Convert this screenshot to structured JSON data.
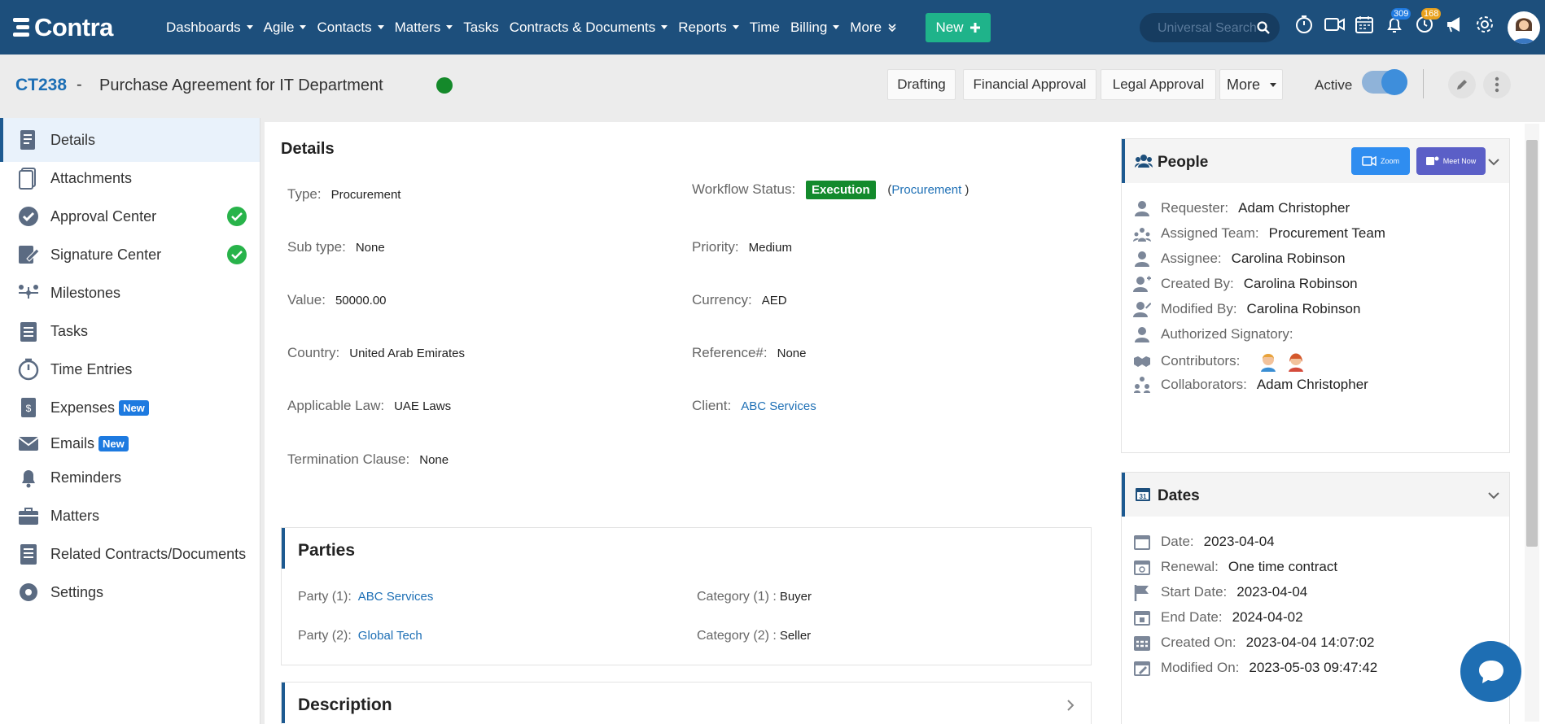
{
  "nav": {
    "brand": "Contra",
    "menu": [
      {
        "label": "Dashboards",
        "dropdown": true
      },
      {
        "label": "Agile",
        "dropdown": true
      },
      {
        "label": "Contacts",
        "dropdown": true
      },
      {
        "label": "Matters",
        "dropdown": true
      },
      {
        "label": "Tasks",
        "dropdown": false
      },
      {
        "label": "Contracts & Documents",
        "dropdown": true
      },
      {
        "label": "Reports",
        "dropdown": true
      },
      {
        "label": "Time",
        "dropdown": false
      },
      {
        "label": "Billing",
        "dropdown": true
      },
      {
        "label": "More",
        "dropdown": true
      }
    ],
    "new_label": "New",
    "search_placeholder": "Universal Search",
    "notifications_count": "309",
    "reminders_count": "168"
  },
  "header": {
    "id": "CT238",
    "dash": "-",
    "title": "Purchase Agreement for IT Department",
    "stages": [
      "Drafting",
      "Financial Approval",
      "Legal Approval"
    ],
    "more_label": "More",
    "active_label": "Active",
    "active_on": true
  },
  "sidebar": {
    "items": [
      {
        "label": "Details",
        "icon": "details-icon",
        "active": true
      },
      {
        "label": "Attachments",
        "icon": "attachments-icon"
      },
      {
        "label": "Approval Center",
        "icon": "approval-badge-icon",
        "check": true
      },
      {
        "label": "Signature Center",
        "icon": "signature-icon",
        "check": true
      },
      {
        "label": "Milestones",
        "icon": "milestones-icon"
      },
      {
        "label": "Tasks",
        "icon": "tasks-clipboard-icon"
      },
      {
        "label": "Time Entries",
        "icon": "stopwatch-icon"
      },
      {
        "label": "Expenses",
        "icon": "expenses-icon",
        "badge": "New"
      },
      {
        "label": "Emails",
        "icon": "email-icon",
        "badge": "New"
      },
      {
        "label": "Reminders",
        "icon": "bell-icon"
      },
      {
        "label": "Matters",
        "icon": "briefcase-icon"
      },
      {
        "label": "Related Contracts/Documents",
        "icon": "related-docs-icon"
      },
      {
        "label": "Settings",
        "icon": "gear-icon"
      }
    ]
  },
  "details": {
    "heading": "Details",
    "type_label": "Type:",
    "type_value": "Procurement",
    "subtype_label": "Sub type:",
    "subtype_value": "None",
    "value_label": "Value:",
    "value_value": "50000.00",
    "country_label": "Country:",
    "country_value": "United Arab Emirates",
    "law_label": "Applicable Law:",
    "law_value": "UAE Laws",
    "termination_label": "Termination Clause:",
    "termination_value": "None",
    "workflow_label": "Workflow Status:",
    "workflow_value": "Execution",
    "workflow_link": "Procurement",
    "priority_label": "Priority:",
    "priority_value": "Medium",
    "currency_label": "Currency:",
    "currency_value": "AED",
    "reference_label": "Reference#:",
    "reference_value": "None",
    "client_label": "Client:",
    "client_value": "ABC Services"
  },
  "parties": {
    "heading": "Parties",
    "rows": [
      {
        "party_label": "Party (1):",
        "party_value": "ABC Services",
        "category_label": "Category (1) :",
        "category_value": "Buyer"
      },
      {
        "party_label": "Party (2):",
        "party_value": "Global Tech",
        "category_label": "Category (2) :",
        "category_value": "Seller"
      }
    ]
  },
  "description": {
    "heading": "Description"
  },
  "people": {
    "heading": "People",
    "zoom_label": "Zoom",
    "meet_label": "Meet Now",
    "rows": [
      {
        "label": "Requester:",
        "value": "Adam Christopher",
        "icon": "user-icon"
      },
      {
        "label": "Assigned Team:",
        "value": "Procurement Team",
        "icon": "team-icon"
      },
      {
        "label": "Assignee:",
        "value": "Carolina Robinson",
        "icon": "user-icon"
      },
      {
        "label": "Created By:",
        "value": "Carolina Robinson",
        "icon": "user-add-icon"
      },
      {
        "label": "Modified By:",
        "value": "Carolina Robinson",
        "icon": "user-edit-icon"
      },
      {
        "label": "Authorized Signatory:",
        "value": "",
        "icon": "user-icon"
      },
      {
        "label": "Contributors:",
        "value": "",
        "icon": "handshake-icon"
      },
      {
        "label": "Collaborators:",
        "value": "Adam Christopher",
        "icon": "collaborators-icon"
      }
    ]
  },
  "dates": {
    "heading": "Dates",
    "rows": [
      {
        "label": "Date:",
        "value": "2023-04-04",
        "icon": "calendar-icon"
      },
      {
        "label": "Renewal:",
        "value": "One time contract",
        "icon": "calendar-renew-icon"
      },
      {
        "label": "Start Date:",
        "value": "2023-04-04",
        "icon": "flag-icon"
      },
      {
        "label": "End Date:",
        "value": "2024-04-02",
        "icon": "calendar-end-icon"
      },
      {
        "label": "Created On:",
        "value": "2023-04-04 14:07:02",
        "icon": "calendar-grid-icon"
      },
      {
        "label": "Modified On:",
        "value": "2023-05-03 09:47:42",
        "icon": "calendar-edit-icon"
      }
    ]
  },
  "colors": {
    "nav_bg": "#1d4f7c",
    "accent": "#1d6fb5",
    "new_btn": "#1fb38a",
    "execution": "#138a2c"
  }
}
